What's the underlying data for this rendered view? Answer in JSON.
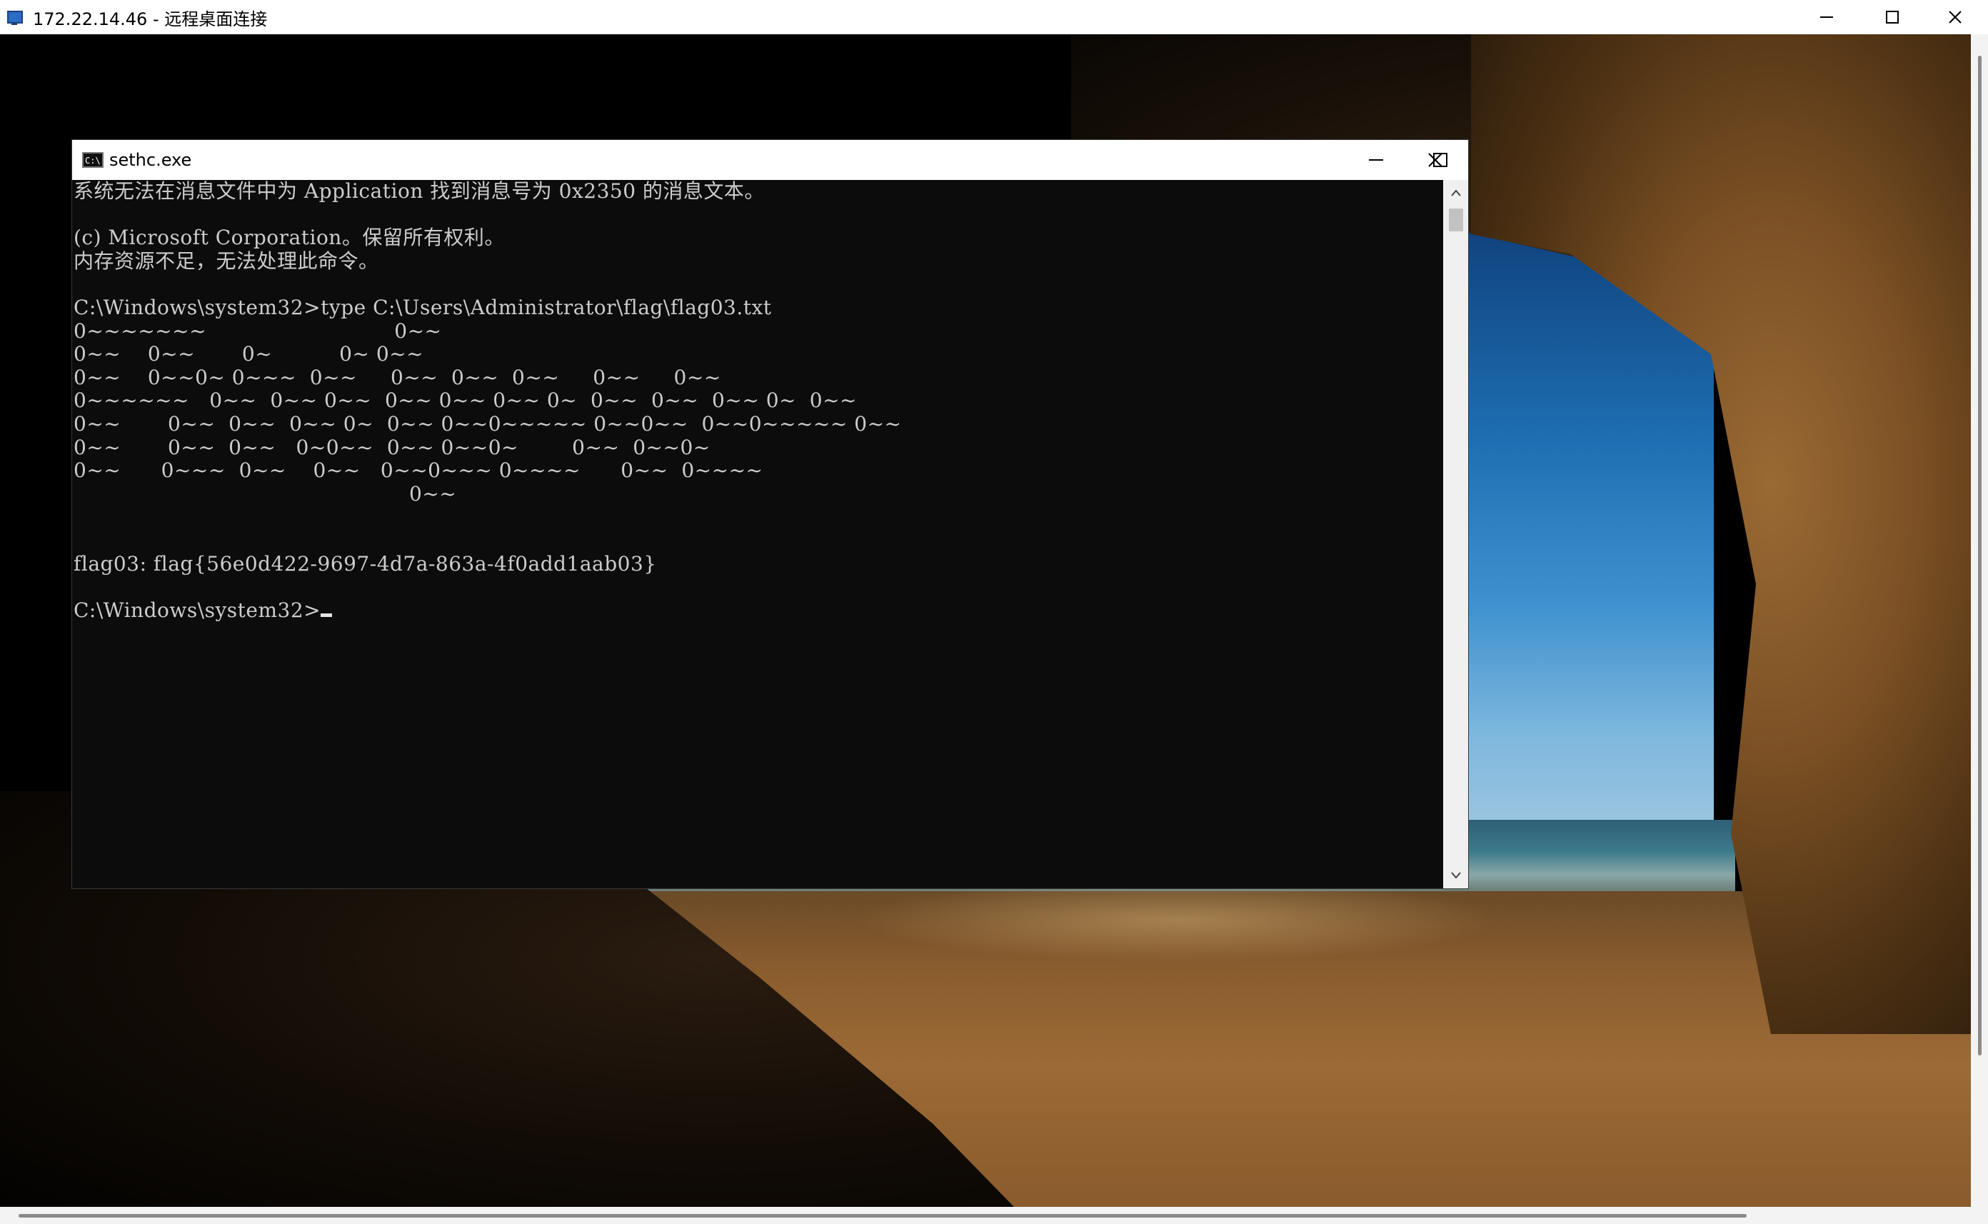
{
  "rdp_window": {
    "title": "172.22.14.46 - 远程桌面连接",
    "icon": "remote-desktop-icon",
    "controls": [
      "minimize-icon",
      "maximize-icon",
      "close-icon"
    ]
  },
  "console_window": {
    "title": "sethc.exe",
    "icon": "cmd-icon",
    "controls": [
      "minimize-icon",
      "maximize-icon",
      "close-icon"
    ],
    "lines": [
      "系统无法在消息文件中为 Application 找到消息号为 0x2350 的消息文本。",
      "",
      "(c) Microsoft Corporation。保留所有权利。",
      "内存资源不足，无法处理此命令。",
      "",
      "C:\\Windows\\system32>type C:\\Users\\Administrator\\flag\\flag03.txt",
      "0~~~~~~~                            0~~",
      "0~~    0~~       0~          0~ 0~~",
      "0~~    0~~0~ 0~~~  0~~     0~~  0~~  0~~     0~~     0~~",
      "0~~~~~~   0~~  0~~ 0~~  0~~ 0~~ 0~~ 0~  0~~  0~~  0~~ 0~  0~~",
      "0~~       0~~  0~~  0~~ 0~  0~~ 0~~0~~~~~ 0~~0~~  0~~0~~~~~ 0~~",
      "0~~       0~~  0~~   0~0~~  0~~ 0~~0~        0~~  0~~0~",
      "0~~      0~~~  0~~    0~~   0~~0~~~ 0~~~~      0~~  0~~~~",
      "                                                  0~~",
      "",
      "",
      "flag03: flag{56e0d422-9697-4d7a-863a-4f0add1aab03}",
      "",
      "C:\\Windows\\system32>"
    ]
  },
  "scrollbars": {
    "console_vertical": [
      "scroll-up-icon",
      "scroll-down-icon"
    ]
  }
}
